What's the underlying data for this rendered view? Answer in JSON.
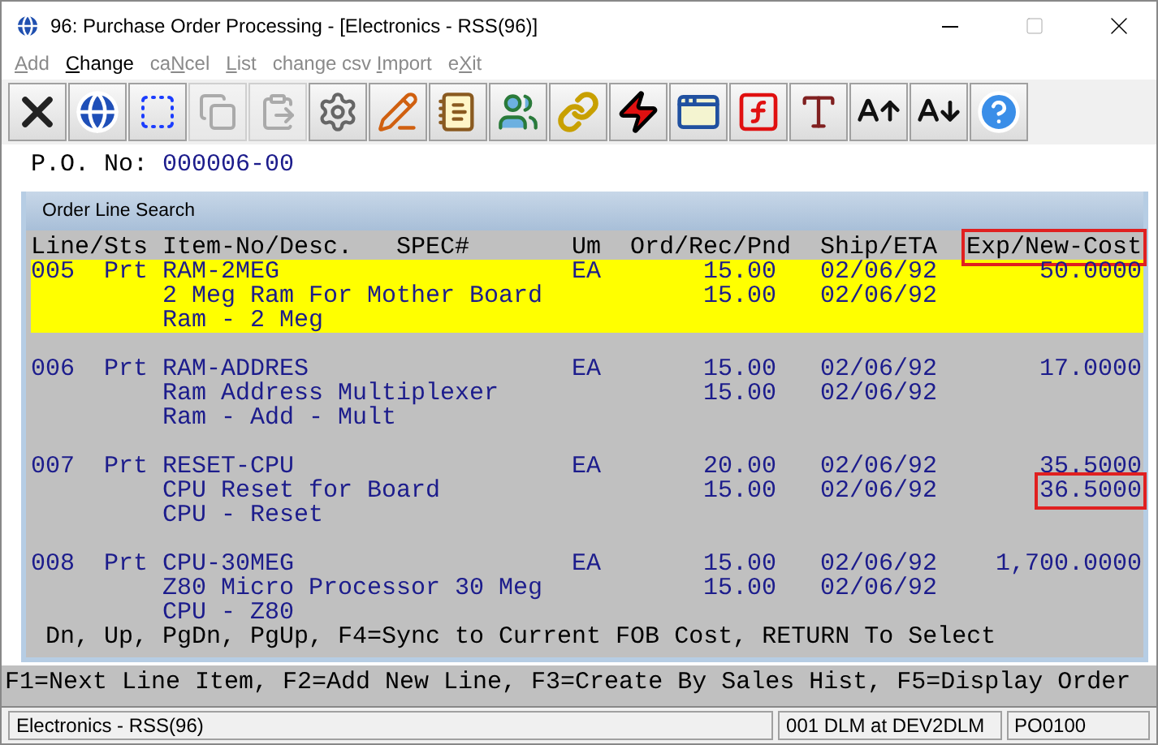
{
  "window": {
    "title": "96: Purchase Order Processing - [Electronics - RSS(96)]"
  },
  "menu": [
    {
      "hotkey": "A",
      "after": "dd",
      "disabled": true
    },
    {
      "hotkey": "C",
      "after": "hange",
      "disabled": false
    },
    {
      "before": "ca",
      "hotkey": "N",
      "after": "cel",
      "disabled": true
    },
    {
      "hotkey": "L",
      "after": "ist",
      "disabled": true
    },
    {
      "before": "change csv ",
      "hotkey": "I",
      "after": "mport",
      "disabled": true
    },
    {
      "before": "e",
      "hotkey": "X",
      "after": "it",
      "disabled": true
    }
  ],
  "toolbar": [
    {
      "kind": "close",
      "disabled": false
    },
    {
      "kind": "globe",
      "disabled": false
    },
    {
      "kind": "select",
      "disabled": false
    },
    {
      "kind": "copy",
      "disabled": true
    },
    {
      "kind": "paste",
      "disabled": true
    },
    {
      "kind": "gear",
      "disabled": false
    },
    {
      "kind": "edit",
      "disabled": false
    },
    {
      "kind": "notepad",
      "disabled": false
    },
    {
      "kind": "users",
      "disabled": false
    },
    {
      "kind": "link",
      "disabled": false
    },
    {
      "kind": "bolt",
      "disabled": false
    },
    {
      "kind": "window-bolt",
      "disabled": false
    },
    {
      "kind": "function",
      "disabled": false
    },
    {
      "kind": "font",
      "disabled": false
    },
    {
      "kind": "font-up",
      "disabled": false
    },
    {
      "kind": "font-down",
      "disabled": false
    },
    {
      "kind": "help",
      "disabled": false
    }
  ],
  "form": {
    "label": "P.O. No:",
    "value": "000006-00"
  },
  "dialog": {
    "title": "Order Line Search",
    "columns": [
      {
        "label": "Line/Sts"
      },
      {
        "label": "Item-No/Desc."
      },
      {
        "label": "SPEC#"
      },
      {
        "label": "Um"
      },
      {
        "label": "Ord/Rec/Pnd"
      },
      {
        "label": "Ship/ETA"
      },
      {
        "label": "Exp/New-Cost",
        "annotated": true
      }
    ],
    "rows": [
      {
        "line": "005",
        "sts": "Prt",
        "item": "RAM-2MEG",
        "um": "EA",
        "ord": "15.00",
        "ship": "02/06/92",
        "cost": "50.0000",
        "desc": "2 Meg Ram For Mother Board",
        "rec": "15.00",
        "eta": "02/06/92",
        "desc2": "Ram - 2 Meg",
        "selected": true
      },
      {
        "line": "006",
        "sts": "Prt",
        "item": "RAM-ADDRES",
        "um": "EA",
        "ord": "15.00",
        "ship": "02/06/92",
        "cost": "17.0000",
        "desc": "Ram Address Multiplexer",
        "rec": "15.00",
        "eta": "02/06/92",
        "desc2": "Ram - Add - Mult",
        "selected": false
      },
      {
        "line": "007",
        "sts": "Prt",
        "item": "RESET-CPU",
        "um": "EA",
        "ord": "20.00",
        "ship": "02/06/92",
        "cost": "35.5000",
        "desc": "CPU Reset for Board",
        "rec": "15.00",
        "eta": "02/06/92",
        "new_cost": "36.5000",
        "new_cost_annotated": true,
        "desc2": "CPU - Reset",
        "selected": false
      },
      {
        "line": "008",
        "sts": "Prt",
        "item": "CPU-30MEG",
        "um": "EA",
        "ord": "15.00",
        "ship": "02/06/92",
        "cost": "1,700.0000",
        "desc": "Z80 Micro Processor 30 Meg",
        "rec": "15.00",
        "eta": "02/06/92",
        "desc2": "CPU - Z80",
        "selected": false
      }
    ],
    "footer": "Dn, Up, PgDn, PgUp, F4=Sync to Current FOB Cost, RETURN To Select"
  },
  "function_keys": "F1=Next Line Item, F2=Add New Line, F3=Create By Sales Hist, F5=Display Order",
  "status_bar": [
    "Electronics - RSS(96)",
    "001 DLM at DEV2DLM",
    "PO0100"
  ]
}
